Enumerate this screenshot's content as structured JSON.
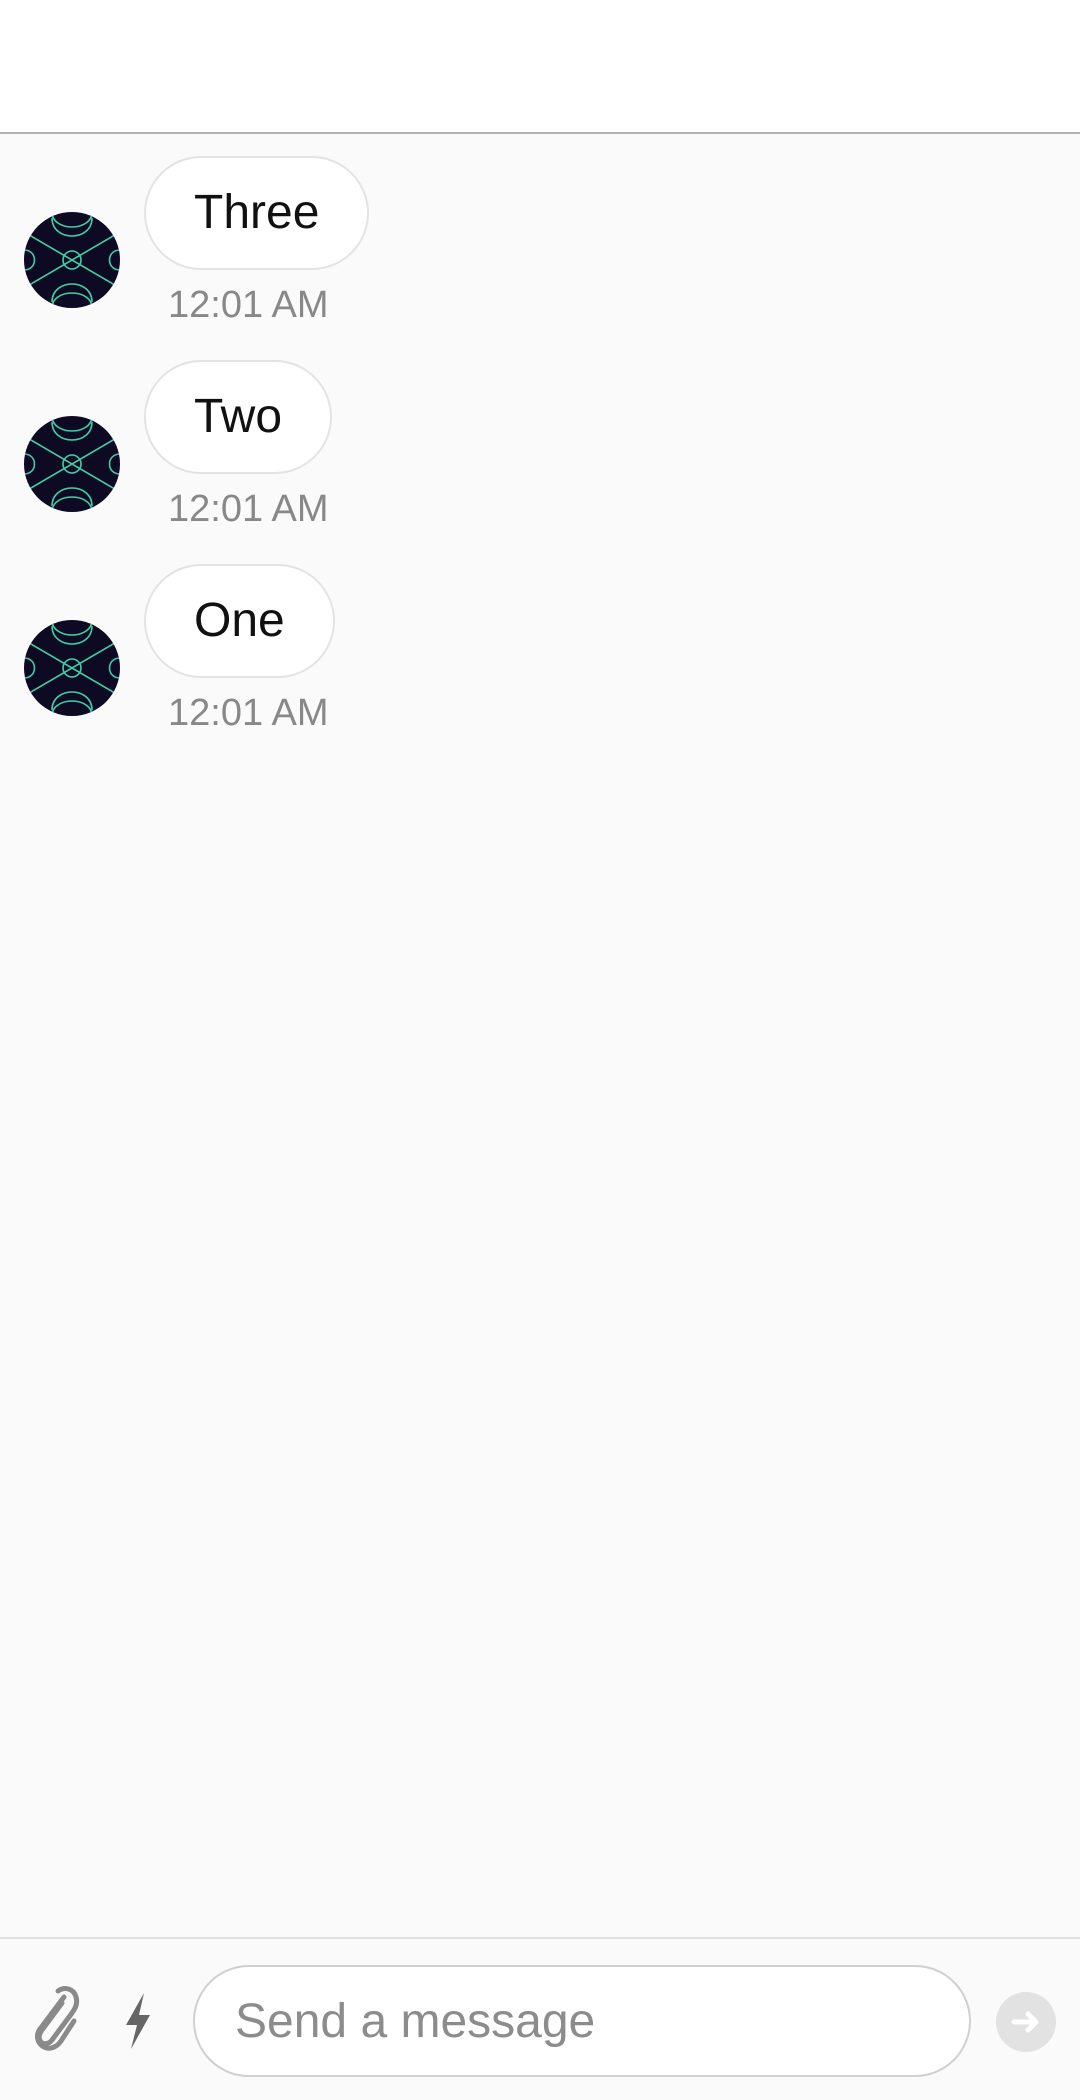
{
  "conversation": {
    "messages": [
      {
        "text": "Three",
        "time": "12:01 AM"
      },
      {
        "text": "Two",
        "time": "12:01 AM"
      },
      {
        "text": "One",
        "time": "12:01 AM"
      }
    ]
  },
  "composer": {
    "placeholder": "Send a message",
    "attach_icon": "paperclip-icon",
    "quick_icon": "lightning-bolt-icon",
    "send_icon": "arrow-right-icon"
  },
  "colors": {
    "avatar_background": "#0e0a24",
    "avatar_pattern": "#3fd0a6",
    "bubble_background": "#ffffff",
    "timestamp": "#888888",
    "send_button_disabled": "#e2e2e2"
  }
}
